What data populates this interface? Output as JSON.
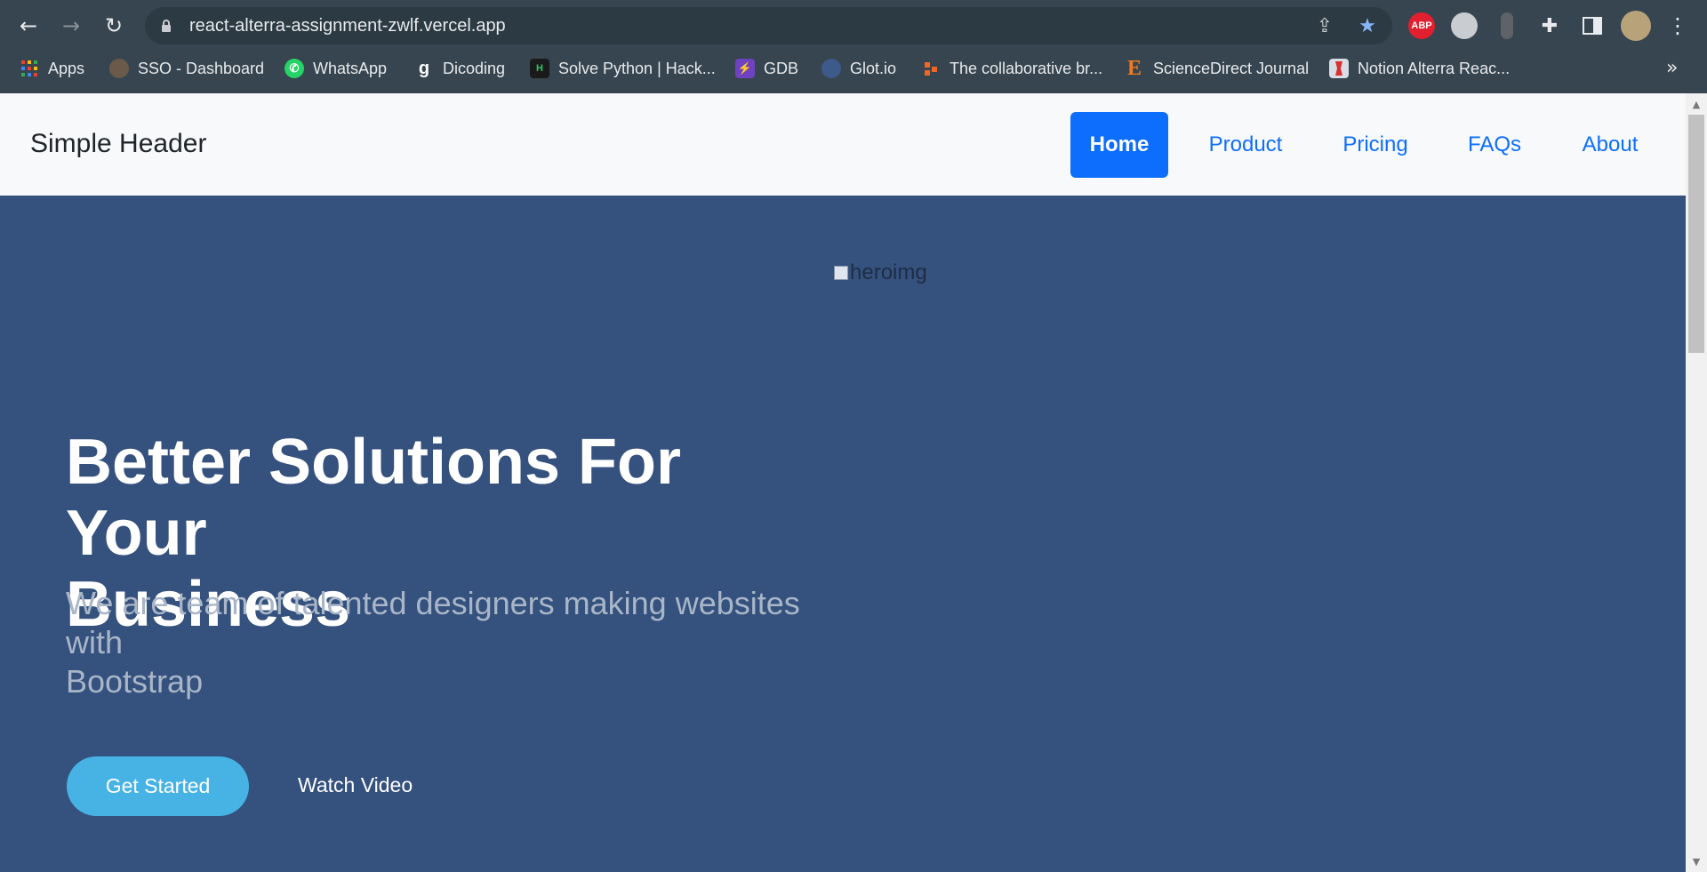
{
  "browser": {
    "url": "react-alterra-assignment-zwlf.vercel.app",
    "extensions": [
      "ABP"
    ],
    "bookmarks": [
      {
        "label": "Apps",
        "icon": "apps-grid-icon"
      },
      {
        "label": "SSO - Dashboard",
        "icon": "sso-icon"
      },
      {
        "label": "WhatsApp",
        "icon": "whatsapp-icon"
      },
      {
        "label": "Dicoding",
        "icon": "dicoding-icon"
      },
      {
        "label": "Solve Python | Hack...",
        "icon": "hackerrank-icon"
      },
      {
        "label": "GDB",
        "icon": "gdb-icon"
      },
      {
        "label": "Glot.io",
        "icon": "glot-icon"
      },
      {
        "label": "The collaborative br...",
        "icon": "collab-icon"
      },
      {
        "label": "ScienceDirect Journal",
        "icon": "sciencedirect-icon"
      },
      {
        "label": "Notion Alterra Reac...",
        "icon": "notion-icon"
      }
    ],
    "bookmarks_overflow": "»"
  },
  "header": {
    "brand": "Simple Header",
    "nav": [
      "Home",
      "Product",
      "Pricing",
      "FAQs",
      "About"
    ],
    "active": "Home"
  },
  "hero": {
    "image_alt": "heroimg",
    "title_line1": "Better Solutions For Your",
    "title_line2": "Business",
    "subtitle_line1": "We are team of talented designers making websites",
    "subtitle_line2": "with",
    "subtitle_line3": "Bootstrap",
    "cta_primary": "Get Started",
    "cta_secondary": "Watch Video"
  },
  "colors": {
    "hero_bg": "#35517e",
    "nav_link": "#0d6efd",
    "cta": "#47b2e4"
  }
}
